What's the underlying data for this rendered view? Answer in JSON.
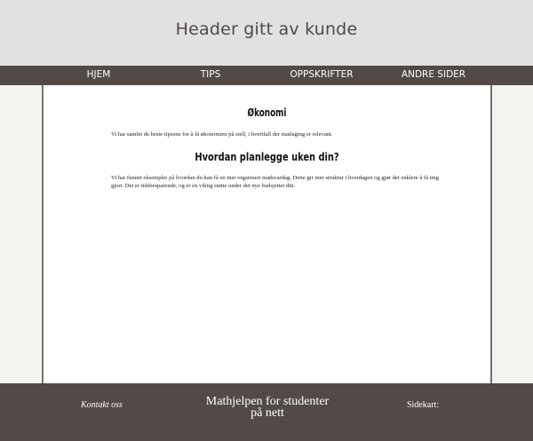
{
  "header": {
    "title": "Header gitt av kunde"
  },
  "nav": {
    "items": [
      {
        "label": "HJEM"
      },
      {
        "label": "TIPS"
      },
      {
        "label": "OPPSKRIFTER"
      },
      {
        "label": "ANDRE SIDER"
      }
    ]
  },
  "main": {
    "heading": "Økonomi",
    "intro": "Vi har samlet de beste tipsene for å få økonomien på stell, i hvertfall der matlaging er relevant.",
    "subheading": "Hvordan planlegge uken din?",
    "paragraph": "Vi har funnet eksempler på hvordan du kan få en mer organisert matkvardag. Dette gir mer struktur i hverdagen og gjør det enklere å få ting gjort. Det er tidsbesparende, og er en viktig støtte under det nye budsjettet ditt."
  },
  "footer": {
    "contact": "Kontakt oss",
    "title_line1": "Mathjelpen for studenter",
    "title_line2": "på nett",
    "sitemap": "Sidekart:"
  },
  "colors": {
    "header_bg": "#e3e0e0",
    "nav_bg": "#524a47",
    "page_bg": "#f2f4ee",
    "content_bg": "#ffffff"
  }
}
